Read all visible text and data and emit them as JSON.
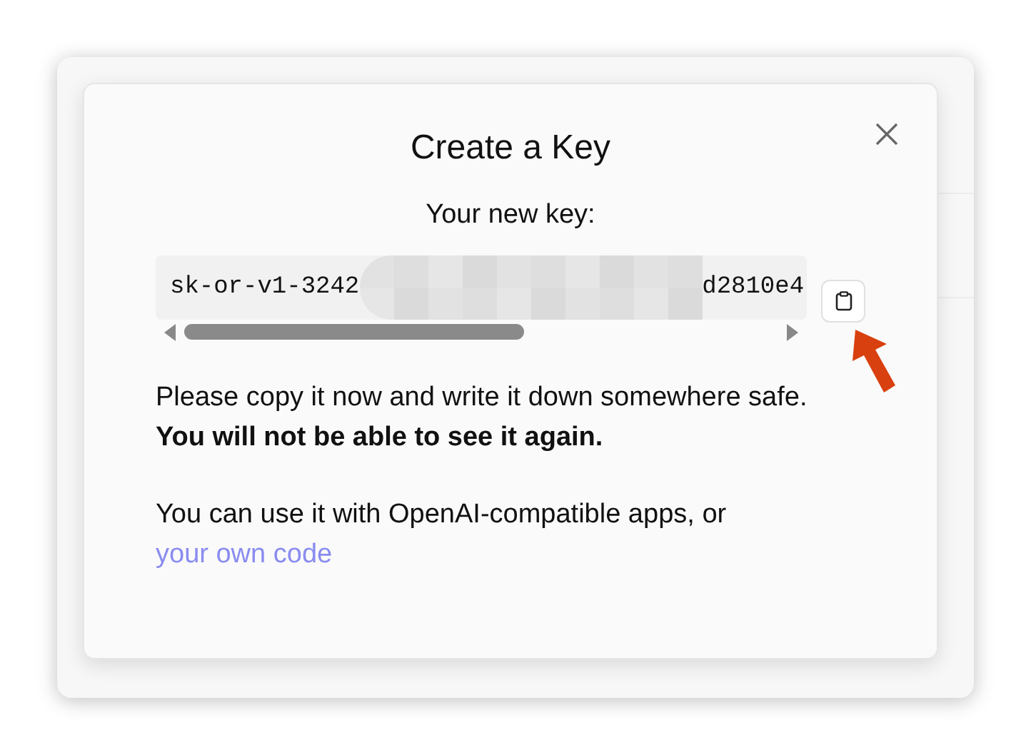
{
  "dialog": {
    "title": "Create a Key",
    "subtitle": "Your new key:",
    "key": {
      "visible_start": "sk-or-v1-3242",
      "visible_end": "d2810e4",
      "redacted": true
    },
    "warning": "Please copy it now and write it down somewhere safe. **You will not be able to see it again.**",
    "usage_text": "You can use it with OpenAI-compatible apps, or",
    "usage_link": "your own code"
  }
}
